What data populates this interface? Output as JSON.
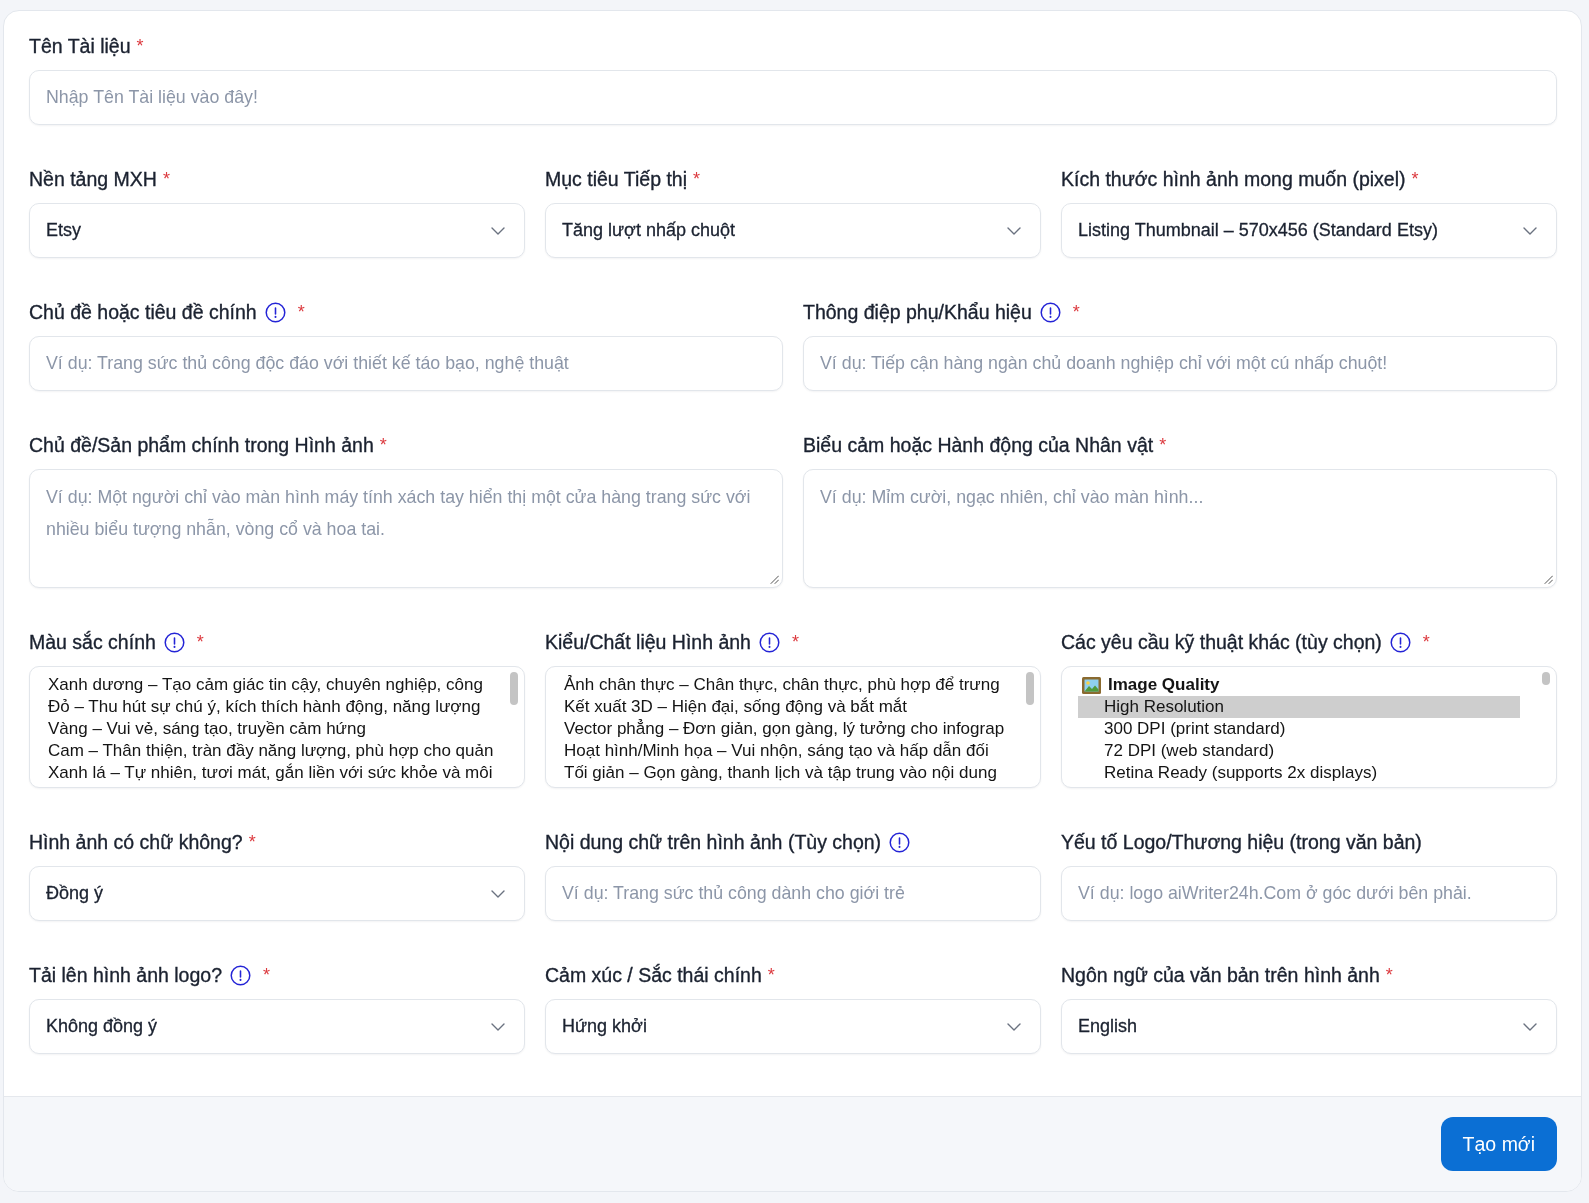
{
  "rows": [
    {
      "fields": [
        {
          "kind": "text",
          "label": "Tên Tài liệu",
          "required_mark": "*",
          "placeholder": "Nhập Tên Tài liệu vào đây!"
        }
      ]
    },
    {
      "fields": [
        {
          "kind": "select",
          "label": "Nền tảng MXH",
          "required_mark": "*",
          "value": "Etsy"
        },
        {
          "kind": "select",
          "label": "Mục tiêu Tiếp thị",
          "required_mark": "*",
          "value": "Tăng lượt nhấp chuột"
        },
        {
          "kind": "select",
          "label": "Kích thước hình ảnh mong muốn (pixel)",
          "required_mark": "*",
          "value": "Listing Thumbnail – 570x456 (Standard Etsy)"
        }
      ]
    },
    {
      "fields": [
        {
          "kind": "text",
          "label": "Chủ đề hoặc tiêu đề chính",
          "required_mark": "*",
          "info": true,
          "placeholder": "Ví dụ: Trang sức thủ công độc đáo với thiết kế táo bạo, nghệ thuật"
        },
        {
          "kind": "text",
          "label": "Thông điệp phụ/Khẩu hiệu",
          "required_mark": "*",
          "info": true,
          "placeholder": "Ví dụ: Tiếp cận hàng ngàn chủ doanh nghiệp chỉ với một cú nhấp chuột!"
        }
      ]
    },
    {
      "fields": [
        {
          "kind": "textarea",
          "label": "Chủ đề/Sản phẩm chính trong Hình ảnh",
          "required_mark": "*",
          "placeholder": "Ví dụ: Một người chỉ vào màn hình máy tính xách tay hiển thị một cửa hàng trang sức với nhiều biểu tượng nhẫn, vòng cổ và hoa tai."
        },
        {
          "kind": "textarea",
          "label": "Biểu cảm hoặc Hành động của Nhân vật",
          "required_mark": "*",
          "placeholder": "Ví dụ: Mỉm cười, ngạc nhiên, chỉ vào màn hình..."
        }
      ]
    },
    {
      "fields": [
        {
          "kind": "listbox",
          "label": "Màu sắc chính",
          "required_mark": "*",
          "info": true,
          "options": [
            {
              "text": "Xanh dương – Tạo cảm giác tin cậy, chuyên nghiệp, công",
              "selected": false
            },
            {
              "text": "Đỏ – Thu hút sự chú ý, kích thích hành động, năng lượng",
              "selected": false
            },
            {
              "text": "Vàng – Vui vẻ, sáng tạo, truyền cảm hứng",
              "selected": false
            },
            {
              "text": "Cam – Thân thiện, tràn đầy năng lượng, phù hợp cho quản",
              "selected": false
            },
            {
              "text": "Xanh lá – Tự nhiên, tươi mát, gắn liền với sức khỏe và môi",
              "selected": false
            }
          ]
        },
        {
          "kind": "listbox",
          "label": "Kiểu/Chất liệu Hình ảnh",
          "required_mark": "*",
          "info": true,
          "options": [
            {
              "text": "Ảnh chân thực – Chân thực, chân thực, phù hợp để trưng",
              "selected": false
            },
            {
              "text": "Kết xuất 3D – Hiện đại, sống động và bắt mắt",
              "selected": false
            },
            {
              "text": "Vector phẳng – Đơn giản, gọn gàng, lý tưởng cho infograp",
              "selected": false
            },
            {
              "text": "Hoạt hình/Minh họa – Vui nhộn, sáng tạo và hấp dẫn đối",
              "selected": false
            },
            {
              "text": "Tối giản – Gọn gàng, thanh lịch và tập trung vào nội dung",
              "selected": false
            }
          ]
        },
        {
          "kind": "grouped_listbox",
          "label": "Các yêu cầu kỹ thuật khác (tùy chọn)",
          "required_mark": "*",
          "info": true,
          "groups": [
            {
              "label": "Image Quality",
              "options": [
                {
                  "text": "High Resolution",
                  "selected": true
                },
                {
                  "text": "300 DPI (print standard)",
                  "selected": false
                },
                {
                  "text": "72 DPI (web standard)",
                  "selected": false
                },
                {
                  "text": "Retina Ready (supports 2x displays)",
                  "selected": false
                }
              ]
            }
          ]
        }
      ]
    },
    {
      "fields": [
        {
          "kind": "select",
          "label": "Hình ảnh có chữ không?",
          "required_mark": "*",
          "value": "Đồng ý"
        },
        {
          "kind": "text",
          "label": "Nội dung chữ trên hình ảnh (Tùy chọn)",
          "info": true,
          "placeholder": "Ví dụ: Trang sức thủ công dành cho giới trẻ"
        },
        {
          "kind": "text",
          "label": "Yếu tố Logo/Thương hiệu (trong văn bản)",
          "placeholder": "Ví dụ: logo aiWriter24h.Com ở góc dưới bên phải."
        }
      ]
    },
    {
      "fields": [
        {
          "kind": "select",
          "label": "Tải lên hình ảnh logo?",
          "required_mark": "*",
          "info": true,
          "value": "Không đồng ý"
        },
        {
          "kind": "select",
          "label": "Cảm xúc / Sắc thái chính",
          "required_mark": "*",
          "value": "Hứng khởi"
        },
        {
          "kind": "select",
          "label": "Ngôn ngữ của văn bản trên hình ảnh",
          "required_mark": "*",
          "value": "English"
        }
      ]
    }
  ],
  "submit_button": "Tạo mới"
}
